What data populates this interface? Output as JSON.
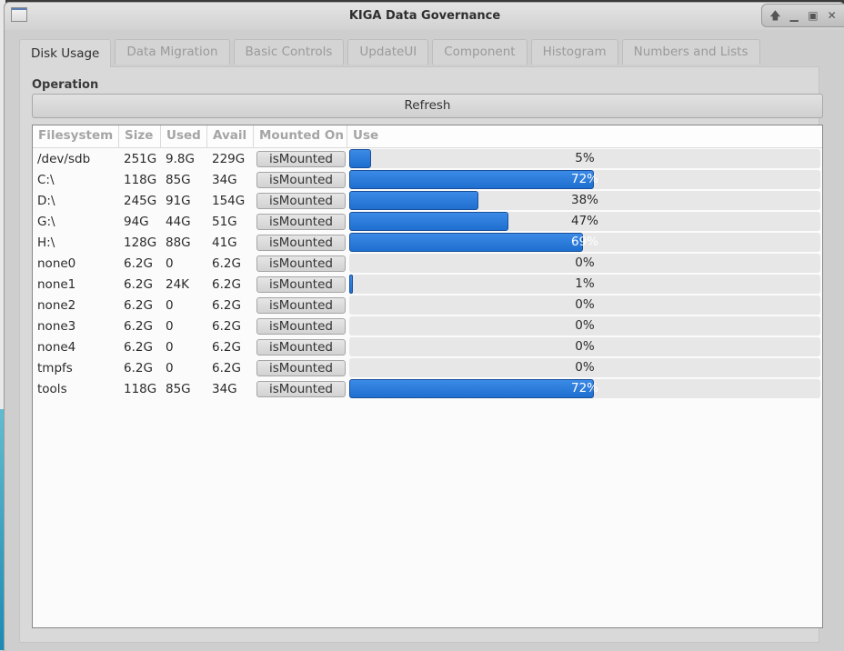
{
  "window": {
    "title": "KIGA Data Governance",
    "buttons": [
      "up-arrow",
      "minimize",
      "maximize",
      "close"
    ]
  },
  "tabs": [
    {
      "label": "Disk Usage",
      "active": true
    },
    {
      "label": "Data Migration",
      "active": false
    },
    {
      "label": "Basic Controls",
      "active": false
    },
    {
      "label": "UpdateUI",
      "active": false
    },
    {
      "label": "Component",
      "active": false
    },
    {
      "label": "Histogram",
      "active": false
    },
    {
      "label": "Numbers and Lists",
      "active": false
    }
  ],
  "operation": {
    "label": "Operation",
    "refresh_label": "Refresh"
  },
  "table": {
    "columns": [
      "Filesystem",
      "Size",
      "Used",
      "Avail",
      "Mounted On",
      "Use"
    ],
    "rows": [
      {
        "filesystem": "/dev/sdb",
        "size": "251G",
        "used": "9.8G",
        "avail": "229G",
        "mounted": "isMounted",
        "use_percent": 5,
        "use_label": "5%"
      },
      {
        "filesystem": "C:\\",
        "size": "118G",
        "used": "85G",
        "avail": "34G",
        "mounted": "isMounted",
        "use_percent": 72,
        "use_label": "72%"
      },
      {
        "filesystem": "D:\\",
        "size": "245G",
        "used": "91G",
        "avail": "154G",
        "mounted": "isMounted",
        "use_percent": 38,
        "use_label": "38%"
      },
      {
        "filesystem": "G:\\",
        "size": "94G",
        "used": "44G",
        "avail": "51G",
        "mounted": "isMounted",
        "use_percent": 47,
        "use_label": "47%"
      },
      {
        "filesystem": "H:\\",
        "size": "128G",
        "used": "88G",
        "avail": "41G",
        "mounted": "isMounted",
        "use_percent": 69,
        "use_label": "69%"
      },
      {
        "filesystem": "none0",
        "size": "6.2G",
        "used": "0",
        "avail": "6.2G",
        "mounted": "isMounted",
        "use_percent": 0,
        "use_label": "0%"
      },
      {
        "filesystem": "none1",
        "size": "6.2G",
        "used": "24K",
        "avail": "6.2G",
        "mounted": "isMounted",
        "use_percent": 1,
        "use_label": "1%"
      },
      {
        "filesystem": "none2",
        "size": "6.2G",
        "used": "0",
        "avail": "6.2G",
        "mounted": "isMounted",
        "use_percent": 0,
        "use_label": "0%"
      },
      {
        "filesystem": "none3",
        "size": "6.2G",
        "used": "0",
        "avail": "6.2G",
        "mounted": "isMounted",
        "use_percent": 0,
        "use_label": "0%"
      },
      {
        "filesystem": "none4",
        "size": "6.2G",
        "used": "0",
        "avail": "6.2G",
        "mounted": "isMounted",
        "use_percent": 0,
        "use_label": "0%"
      },
      {
        "filesystem": "tmpfs",
        "size": "6.2G",
        "used": "0",
        "avail": "6.2G",
        "mounted": "isMounted",
        "use_percent": 0,
        "use_label": "0%"
      },
      {
        "filesystem": "tools",
        "size": "118G",
        "used": "85G",
        "avail": "34G",
        "mounted": "isMounted",
        "use_percent": 72,
        "use_label": "72%"
      }
    ]
  },
  "colors": {
    "progress_fill": "#2a7bdc",
    "progress_track": "#e7e7e7"
  }
}
